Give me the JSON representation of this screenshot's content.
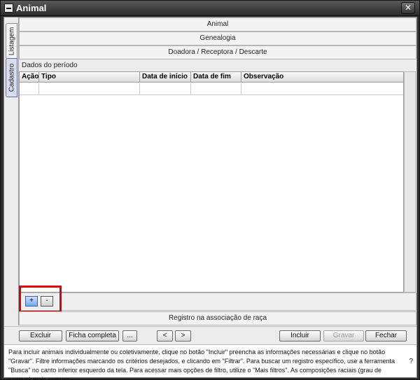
{
  "window": {
    "title": "Animal",
    "close_glyph": "✕"
  },
  "tabs": {
    "listagem": "Listagem",
    "cadastro": "Cadastro"
  },
  "sections": {
    "animal": "Animal",
    "genealogia": "Genealogia",
    "doadora": "Doadora / Receptora / Descarte",
    "periodo_label": "Dados do período",
    "registro": "Registro na associação de raça"
  },
  "grid": {
    "columns": [
      "Ação",
      "Tipo",
      "Data de início",
      "Data de fim",
      "Observação"
    ],
    "rows": [
      [
        "",
        "",
        "",
        "",
        ""
      ]
    ]
  },
  "grid_buttons": {
    "add": "+",
    "remove": "-"
  },
  "toolbar": {
    "excluir": "Excluir",
    "ficha": "Ficha completa",
    "more": "...",
    "prev": "<",
    "next": ">",
    "incluir": "Incluir",
    "gravar": "Gravar",
    "fechar": "Fechar"
  },
  "help": {
    "text": "Para incluir animais individualmente ou coletivamente, clique no botão \"Incluir\" preencha as informações necessárias e clique no botão \"Gravar\". Filtre informações marcando os critérios desejados, e clicando em \"Filtrar\". Para buscar um registro específico, use a ferramenta \"Busca\" no canto inferior esquerdo da tela. Para acessar mais opções de filtro, utilize o \"Mais filtros\". As composições raciais (grau de sangue) mais comuns",
    "question": "?"
  }
}
